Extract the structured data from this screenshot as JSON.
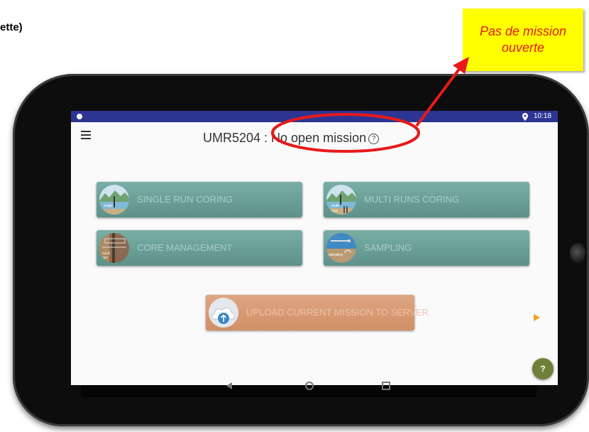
{
  "annotation": {
    "caption_fragment": "ette)",
    "callout_line1": "Pas de mission",
    "callout_line2": "ouverte"
  },
  "statusbar": {
    "time": "10:18",
    "location_icon": "location-pin-icon"
  },
  "appbar": {
    "menu_icon": "hamburger-menu-icon",
    "title": "UMR5204 : No open mission",
    "help_badge": "?"
  },
  "buttons": {
    "single_run": "SINGLE RUN CORING",
    "multi_run": "MULTI RUNS CORING",
    "core_management": "CORE MANAGEMENT",
    "sampling": "SAMPLING",
    "upload": "UPLOAD CURRENT MISSION TO SERVER"
  },
  "icon_text": {
    "single_run_tag": "single",
    "multi_run_tag": "multi",
    "multi_run_sub": "runs",
    "core_management_tag1": "cut &",
    "core_management_tag2": "run",
    "sampling_tag": "sampling"
  },
  "fab": {
    "label": "?"
  },
  "colors": {
    "statusbar": "#2d3592",
    "teal_button": "#6a9f97",
    "upload_button": "#d89a72",
    "fab": "#6f8138",
    "callout_bg": "#ffff00",
    "callout_text": "#e31b1b",
    "annotation_red": "#e8191a"
  }
}
